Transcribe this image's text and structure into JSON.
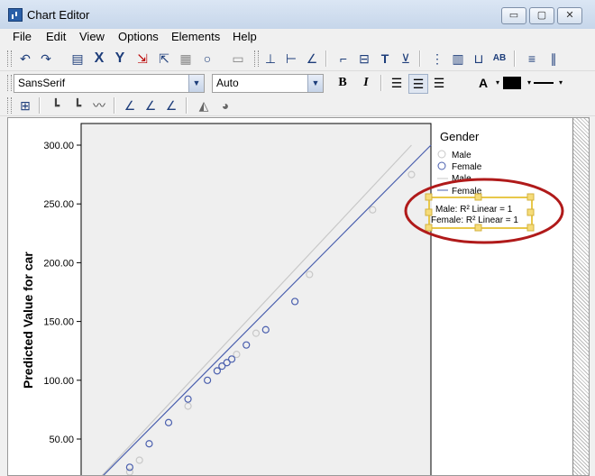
{
  "window": {
    "title": "Chart Editor",
    "minimize_symbol": "▭",
    "maximize_symbol": "▢",
    "close_symbol": "✕"
  },
  "menu": [
    "File",
    "Edit",
    "View",
    "Options",
    "Elements",
    "Help"
  ],
  "toolbar": {
    "font_family": "SansSerif",
    "font_size": "Auto",
    "bold_label": "B",
    "italic_label": "I",
    "x_label": "X",
    "y_label": "Y",
    "text_box_label": "T"
  },
  "chart_data": {
    "type": "scatter",
    "ylabel": "Predicted Value for car",
    "y_ticks": [
      "300.00",
      "250.00",
      "200.00",
      "150.00",
      "100.00",
      "50.00"
    ],
    "legend_title": "Gender",
    "legend_entries": [
      "Male",
      "Female",
      "Male",
      "Female"
    ],
    "fit_labels": [
      "Male: R² Linear = 1",
      "Female: R² Linear = 1"
    ],
    "series": [
      {
        "name": "Male",
        "color": "#c8c8c8",
        "fit": [
          [
            -30,
            0
          ],
          [
            310,
            300
          ]
        ],
        "points": [
          [
            0,
            5
          ],
          [
            10,
            15
          ],
          [
            20,
            22
          ],
          [
            30,
            32
          ],
          [
            80,
            78
          ],
          [
            130,
            122
          ],
          [
            150,
            140
          ],
          [
            205,
            190
          ],
          [
            270,
            245
          ],
          [
            310,
            275
          ]
        ]
      },
      {
        "name": "Female",
        "color": "#4a5fae",
        "fit": [
          [
            -30,
            0
          ],
          [
            330,
            300
          ]
        ],
        "points": [
          [
            0,
            8
          ],
          [
            20,
            26
          ],
          [
            40,
            46
          ],
          [
            60,
            64
          ],
          [
            80,
            84
          ],
          [
            100,
            100
          ],
          [
            110,
            108
          ],
          [
            115,
            112
          ],
          [
            120,
            115
          ],
          [
            125,
            118
          ],
          [
            140,
            130
          ],
          [
            160,
            143
          ],
          [
            190,
            167
          ]
        ]
      }
    ],
    "ylim": [
      10,
      315
    ],
    "xlim": [
      -30,
      330
    ],
    "legend_position": "right",
    "grid": false
  }
}
